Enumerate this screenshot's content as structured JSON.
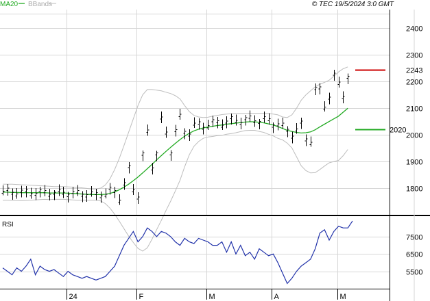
{
  "header": {
    "legend_ma": "MA20",
    "legend_bb": "BBands",
    "copyright": "© TEC 19/5/2024 3:0 GMT"
  },
  "colors": {
    "ma": "#22aa22",
    "bbands": "#bdbdbd",
    "rsi": "#2233aa",
    "resistance": "#cc0000",
    "support": "#22aa22"
  },
  "chart_data": [
    {
      "type": "line",
      "title": "",
      "ylim": [
        1700,
        2470
      ],
      "yticks": [
        "2400",
        "2300",
        "2200",
        "2100",
        "2000",
        "1900",
        "1800"
      ],
      "xticks": [
        "24",
        "F",
        "M",
        "A",
        "M"
      ],
      "levels": [
        {
          "label": "2243",
          "value": 2243
        },
        {
          "label": "2020",
          "value": 2020
        }
      ],
      "series": [
        {
          "name": "MA20",
          "values": [
            1785,
            1785,
            1784,
            1784,
            1783,
            1783,
            1783,
            1783,
            1783,
            1783,
            1782,
            1782,
            1782,
            1782,
            1781,
            1780,
            1779,
            1778,
            1777,
            1776,
            1776,
            1776,
            1777,
            1780,
            1786,
            1794,
            1804,
            1815,
            1828,
            1842,
            1857,
            1873,
            1889,
            1906,
            1922,
            1938,
            1953,
            1968,
            1982,
            1995,
            2006,
            2015,
            2021,
            2026,
            2029,
            2032,
            2035,
            2037,
            2040,
            2042,
            2044,
            2046,
            2048,
            2049,
            2049,
            2047,
            2045,
            2041,
            2037,
            2031,
            2024,
            2017,
            2013,
            2009,
            2007,
            2008,
            2011,
            2019,
            2030,
            2040,
            2050,
            2060,
            2070,
            2085,
            2100
          ]
        },
        {
          "name": "BBands",
          "values": [
            1815,
            1815,
            1815,
            1814,
            1813,
            1812,
            1811,
            1810,
            1809,
            1808,
            1807,
            1806,
            1806,
            1806,
            1805,
            1804,
            1803,
            1801,
            1799,
            1797,
            1797,
            1800,
            1812,
            1835,
            1870,
            1912,
            1960,
            2010,
            2060,
            2110,
            2150,
            2170,
            2170,
            2168,
            2165,
            2160,
            2155,
            2147,
            2135,
            2110,
            2087,
            2073,
            2067,
            2065,
            2066,
            2070,
            2073,
            2076,
            2078,
            2079,
            2080,
            2080,
            2080,
            2081,
            2081,
            2081,
            2081,
            2080,
            2078,
            2075,
            2067,
            2065,
            2075,
            2100,
            2130,
            2150,
            2165,
            2180,
            2190,
            2197,
            2205,
            2220,
            2236,
            2248,
            2255
          ]
        },
        {
          "name": "BBands-lower",
          "values": [
            1755,
            1755,
            1754,
            1754,
            1753,
            1754,
            1755,
            1756,
            1757,
            1758,
            1757,
            1758,
            1758,
            1758,
            1757,
            1756,
            1755,
            1755,
            1755,
            1755,
            1755,
            1752,
            1742,
            1725,
            1702,
            1676,
            1648,
            1620,
            1596,
            1574,
            1564,
            1576,
            1608,
            1644,
            1679,
            1716,
            1751,
            1789,
            1829,
            1880,
            1925,
            1957,
            1975,
            1987,
            1992,
            1994,
            1997,
            1998,
            2002,
            2005,
            2008,
            2012,
            2016,
            2017,
            2017,
            2013,
            2009,
            2002,
            1996,
            1987,
            1981,
            1969,
            1951,
            1918,
            1884,
            1866,
            1857,
            1858,
            1870,
            1883,
            1895,
            1900,
            1904,
            1922,
            1945
          ]
        }
      ]
    },
    {
      "type": "line",
      "title": "RSI",
      "ylim": [
        45,
        86
      ],
      "yticks": [
        "7500",
        "6500",
        "5500"
      ],
      "series": [
        {
          "name": "",
          "values": [
            57,
            55,
            53,
            57,
            55,
            58,
            62,
            53,
            58,
            56,
            55,
            56,
            54,
            52,
            55,
            53,
            52,
            51,
            52,
            51,
            50,
            51,
            52,
            55,
            58,
            64,
            70,
            74,
            78,
            72,
            75,
            80,
            78,
            75,
            78,
            77,
            75,
            72,
            70,
            74,
            72,
            71,
            74,
            73,
            72,
            70,
            70,
            72,
            66,
            72,
            65,
            70,
            64,
            66,
            62,
            68,
            66,
            64,
            65,
            60,
            54,
            48,
            51,
            55,
            58,
            60,
            62,
            68,
            77,
            79,
            73,
            78,
            81,
            80,
            80,
            84
          ]
        }
      ]
    }
  ]
}
